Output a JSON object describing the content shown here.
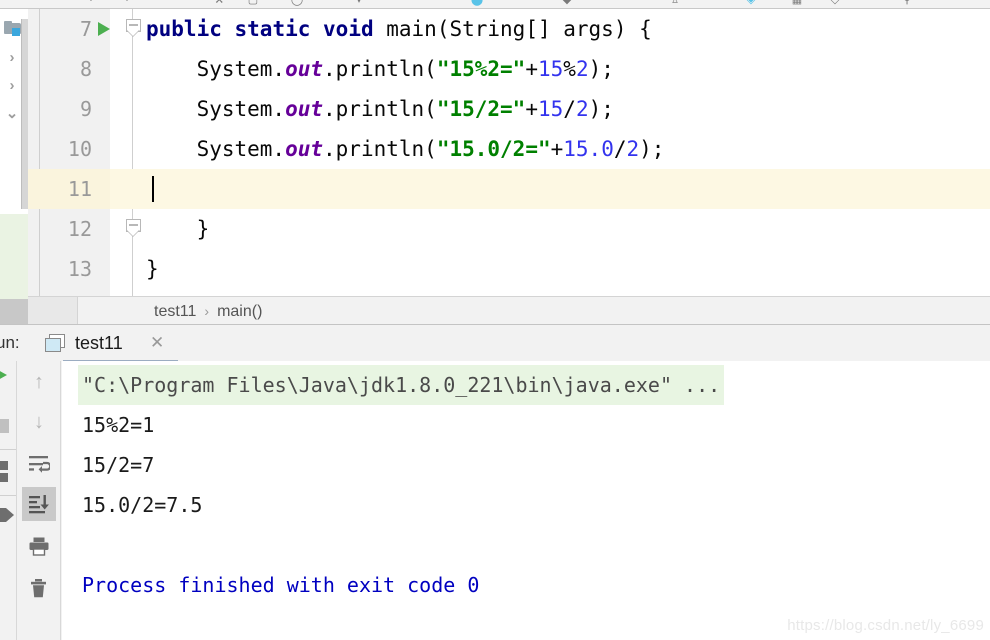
{
  "toolbar": {
    "icons": [
      "undo-icon",
      "redo-icon",
      "compile-icon",
      "app-icon",
      "search-icon",
      "run-config-icon",
      "debug-icon",
      "profile-icon",
      "settings-icon",
      "help-icon"
    ]
  },
  "project_sidebar": {
    "folder_label": "project-folder-icon",
    "chevrons": [
      "chevron-right",
      "chevron-right",
      "chevron-down"
    ]
  },
  "editor": {
    "lines": [
      {
        "number": "7",
        "has_run_arrow": true,
        "has_fold": true,
        "fold_type": "open",
        "highlight": false,
        "tokens": [
          {
            "t": "public",
            "c": "kw"
          },
          {
            "t": " ",
            "c": "pln"
          },
          {
            "t": "static",
            "c": "kw"
          },
          {
            "t": " ",
            "c": "pln"
          },
          {
            "t": "void",
            "c": "kw"
          },
          {
            "t": " main(String[] args) {",
            "c": "pln"
          }
        ]
      },
      {
        "number": "8",
        "has_run_arrow": false,
        "has_fold": false,
        "highlight": false,
        "tokens": [
          {
            "t": "    System.",
            "c": "pln"
          },
          {
            "t": "out",
            "c": "fld"
          },
          {
            "t": ".println(",
            "c": "pln"
          },
          {
            "t": "\"15%2=\"",
            "c": "str"
          },
          {
            "t": "+",
            "c": "pln"
          },
          {
            "t": "15",
            "c": "num"
          },
          {
            "t": "%",
            "c": "pln"
          },
          {
            "t": "2",
            "c": "num"
          },
          {
            "t": ");",
            "c": "pln"
          }
        ]
      },
      {
        "number": "9",
        "has_run_arrow": false,
        "has_fold": false,
        "highlight": false,
        "tokens": [
          {
            "t": "    System.",
            "c": "pln"
          },
          {
            "t": "out",
            "c": "fld"
          },
          {
            "t": ".println(",
            "c": "pln"
          },
          {
            "t": "\"15/2=\"",
            "c": "str"
          },
          {
            "t": "+",
            "c": "pln"
          },
          {
            "t": "15",
            "c": "num"
          },
          {
            "t": "/",
            "c": "pln"
          },
          {
            "t": "2",
            "c": "num"
          },
          {
            "t": ");",
            "c": "pln"
          }
        ]
      },
      {
        "number": "10",
        "has_run_arrow": false,
        "has_fold": false,
        "highlight": false,
        "tokens": [
          {
            "t": "    System.",
            "c": "pln"
          },
          {
            "t": "out",
            "c": "fld"
          },
          {
            "t": ".println(",
            "c": "pln"
          },
          {
            "t": "\"15.0/2=\"",
            "c": "str"
          },
          {
            "t": "+",
            "c": "pln"
          },
          {
            "t": "15.0",
            "c": "num"
          },
          {
            "t": "/",
            "c": "pln"
          },
          {
            "t": "2",
            "c": "num"
          },
          {
            "t": ");",
            "c": "pln"
          }
        ]
      },
      {
        "number": "11",
        "has_run_arrow": false,
        "has_fold": false,
        "highlight": true,
        "has_caret": true,
        "tokens": []
      },
      {
        "number": "12",
        "has_run_arrow": false,
        "has_fold": true,
        "fold_type": "close",
        "highlight": false,
        "tokens": [
          {
            "t": "    }",
            "c": "pln"
          }
        ]
      },
      {
        "number": "13",
        "has_run_arrow": false,
        "has_fold": false,
        "highlight": false,
        "tokens": [
          {
            "t": "}",
            "c": "pln"
          }
        ]
      }
    ]
  },
  "breadcrumb": {
    "class_name": "test11",
    "separator": "›",
    "method_name": "main()"
  },
  "run_window": {
    "title": "un:",
    "tab_name": "test11",
    "close_glyph": "✕",
    "toolbar": [
      {
        "name": "rerun-icon",
        "glyph": "run"
      },
      {
        "name": "stop-icon",
        "glyph": "stop"
      },
      {
        "name": "thread-dump-icon",
        "glyph": "stack"
      },
      {
        "name": "resume-icon",
        "glyph": "resume"
      }
    ],
    "console_toolbar": [
      {
        "name": "scroll-up-icon",
        "glyph": "↑",
        "state": "dim"
      },
      {
        "name": "scroll-down-icon",
        "glyph": "↓",
        "state": "dim"
      },
      {
        "name": "soft-wrap-icon",
        "glyph": "wrap",
        "state": "normal"
      },
      {
        "name": "scroll-to-end-icon",
        "glyph": "end",
        "state": "active"
      },
      {
        "name": "print-icon",
        "glyph": "print",
        "state": "normal"
      },
      {
        "name": "clear-all-icon",
        "glyph": "trash",
        "state": "normal"
      }
    ],
    "console_lines": [
      {
        "text": "\"C:\\Program Files\\Java\\jdk1.8.0_221\\bin\\java.exe\" ...",
        "kind": "cmd"
      },
      {
        "text": "15%2=1",
        "kind": "out"
      },
      {
        "text": "15/2=7",
        "kind": "out"
      },
      {
        "text": "15.0/2=7.5",
        "kind": "out"
      },
      {
        "text": "",
        "kind": "out"
      },
      {
        "text": "Process finished with exit code 0",
        "kind": "fin"
      }
    ]
  },
  "watermark": {
    "text": "https://blog.csdn.net/ly_6699"
  },
  "colors": {
    "keyword": "#000080",
    "string": "#008000",
    "number": "#3333ee",
    "field": "#660099",
    "caret_line": "#fdf8e3",
    "cmd_bg": "#e8f5e2",
    "finish_text": "#0000c0",
    "run_green": "#4caf50"
  }
}
